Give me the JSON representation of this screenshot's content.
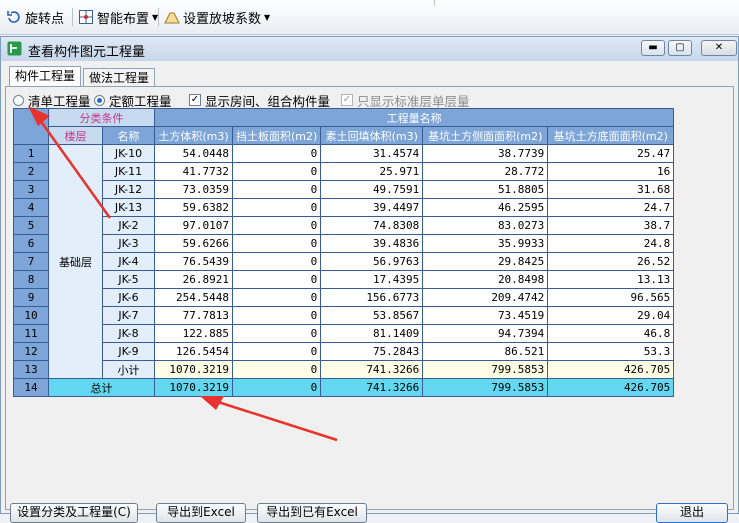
{
  "toolbar": {
    "rotate_label": "旋转点",
    "smart_label": "智能布置",
    "slope_label": "设置放坡系数"
  },
  "dialog": {
    "title": "查看构件图元工程量",
    "tabs": [
      "构件工程量",
      "做法工程量"
    ],
    "options": {
      "bill_qty": "清单工程量",
      "quota_qty": "定额工程量",
      "show_rooms": "显示房间、组合构件量",
      "std_floor_only": "只显示标准层单层量"
    },
    "table": {
      "group_header_category": "分类条件",
      "group_header_qty": "工程量名称",
      "col_floor": "楼层",
      "col_name": "名称",
      "columns": [
        "土方体积(m3)",
        "挡土板面积(m2)",
        "素土回填体积(m3)",
        "基坑土方侧面面积(m2)",
        "基坑土方底面面积(m2)"
      ],
      "floor": "基础层",
      "rows": [
        {
          "no": "1",
          "name": "JK-10",
          "v": [
            "54.0448",
            "0",
            "31.4574",
            "38.7739",
            "25.47"
          ]
        },
        {
          "no": "2",
          "name": "JK-11",
          "v": [
            "41.7732",
            "0",
            "25.971",
            "28.772",
            "16"
          ]
        },
        {
          "no": "3",
          "name": "JK-12",
          "v": [
            "73.0359",
            "0",
            "49.7591",
            "51.8805",
            "31.68"
          ]
        },
        {
          "no": "4",
          "name": "JK-13",
          "v": [
            "59.6382",
            "0",
            "39.4497",
            "46.2595",
            "24.7"
          ]
        },
        {
          "no": "5",
          "name": "JK-2",
          "v": [
            "97.0107",
            "0",
            "74.8308",
            "83.0273",
            "38.7"
          ]
        },
        {
          "no": "6",
          "name": "JK-3",
          "v": [
            "59.6266",
            "0",
            "39.4836",
            "35.9933",
            "24.8"
          ]
        },
        {
          "no": "7",
          "name": "JK-4",
          "v": [
            "76.5439",
            "0",
            "56.9763",
            "29.8425",
            "26.52"
          ]
        },
        {
          "no": "8",
          "name": "JK-5",
          "v": [
            "26.8921",
            "0",
            "17.4395",
            "20.8498",
            "13.13"
          ]
        },
        {
          "no": "9",
          "name": "JK-6",
          "v": [
            "254.5448",
            "0",
            "156.6773",
            "209.4742",
            "96.565"
          ]
        },
        {
          "no": "10",
          "name": "JK-7",
          "v": [
            "77.7813",
            "0",
            "53.8567",
            "73.4519",
            "29.04"
          ]
        },
        {
          "no": "11",
          "name": "JK-8",
          "v": [
            "122.885",
            "0",
            "81.1409",
            "94.7394",
            "46.8"
          ]
        },
        {
          "no": "12",
          "name": "JK-9",
          "v": [
            "126.5454",
            "0",
            "75.2843",
            "86.521",
            "53.3"
          ]
        }
      ],
      "subtotal": {
        "no": "13",
        "label": "小计",
        "v": [
          "1070.3219",
          "0",
          "741.3266",
          "799.5853",
          "426.705"
        ]
      },
      "total": {
        "no": "14",
        "label": "总计",
        "v": [
          "1070.3219",
          "0",
          "741.3266",
          "799.5853",
          "426.705"
        ]
      }
    },
    "buttons": {
      "set_category": "设置分类及工程量(C)",
      "export_excel": "导出到Excel",
      "export_open_excel": "导出到已有Excel",
      "exit": "退出"
    }
  },
  "colors": {
    "header_blue": "#7ea5d8",
    "total_cyan": "#63d7ef",
    "subtotal_yellow": "#fffde5",
    "arrow_red": "#e8322d"
  }
}
